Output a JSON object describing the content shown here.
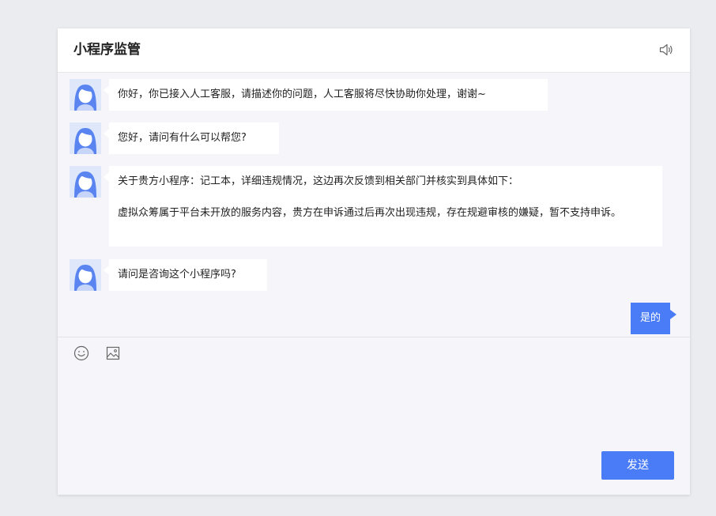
{
  "header": {
    "title": "小程序监管",
    "sound_icon": "speaker-icon"
  },
  "messages": [
    {
      "sender": "agent",
      "avatar_icon": "agent-avatar-icon",
      "paragraphs": [
        "你好，你已接入人工客服，请描述你的问题，人工客服将尽快协助你处理，谢谢~"
      ]
    },
    {
      "sender": "agent",
      "avatar_icon": "agent-avatar-icon",
      "paragraphs": [
        "您好，请问有什么可以帮您?"
      ]
    },
    {
      "sender": "agent",
      "avatar_icon": "agent-avatar-icon",
      "paragraphs": [
        "关于贵方小程序：记工本，详细违规情况，这边再次反馈到相关部门并核实到具体如下：",
        "虚拟众筹属于平台未开放的服务内容，贵方在申诉通过后再次出现违规，存在规避审核的嫌疑，暂不支持申诉。"
      ]
    },
    {
      "sender": "agent",
      "avatar_icon": "agent-avatar-icon",
      "paragraphs": [
        "请问是咨询这个小程序吗?"
      ]
    },
    {
      "sender": "user",
      "paragraphs": [
        "是的"
      ]
    }
  ],
  "composer": {
    "emoji_icon": "emoji-icon",
    "image_icon": "image-icon",
    "send_label": "发送"
  },
  "colors": {
    "accent": "#4a7cf7",
    "background": "#ebecf0",
    "chat_background": "#f6f6fa",
    "bubble": "#ffffff"
  }
}
